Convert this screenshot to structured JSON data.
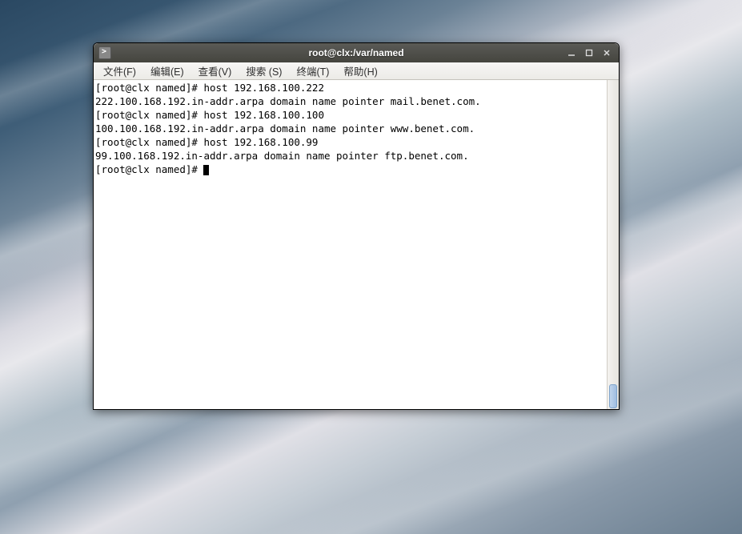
{
  "window": {
    "title": "root@clx:/var/named"
  },
  "menu": {
    "file": "文件(F)",
    "edit": "编辑(E)",
    "view": "查看(V)",
    "search": "搜索 (S)",
    "terminal": "终端(T)",
    "help": "帮助(H)"
  },
  "terminal": {
    "lines": [
      "[root@clx named]# host 192.168.100.222",
      "222.100.168.192.in-addr.arpa domain name pointer mail.benet.com.",
      "[root@clx named]# host 192.168.100.100",
      "100.100.168.192.in-addr.arpa domain name pointer www.benet.com.",
      "[root@clx named]# host 192.168.100.99",
      "99.100.168.192.in-addr.arpa domain name pointer ftp.benet.com.",
      "[root@clx named]# "
    ],
    "prompt": "[root@clx named]# "
  },
  "controls": {
    "minimize": "–",
    "maximize": "□",
    "close": "✕"
  }
}
